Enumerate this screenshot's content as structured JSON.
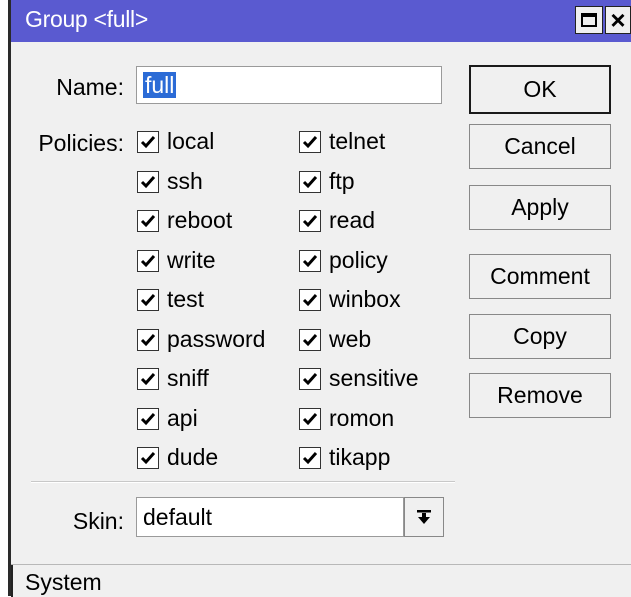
{
  "window": {
    "title": "Group <full>",
    "controls": {
      "maximize": "maximize-icon",
      "close": "×"
    }
  },
  "form": {
    "name_label": "Name:",
    "name_value": "full",
    "policies_label": "Policies:",
    "skin_label": "Skin:",
    "skin_value": "default"
  },
  "policies_left": [
    {
      "label": "local",
      "checked": true
    },
    {
      "label": "ssh",
      "checked": true
    },
    {
      "label": "reboot",
      "checked": true
    },
    {
      "label": "write",
      "checked": true
    },
    {
      "label": "test",
      "checked": true
    },
    {
      "label": "password",
      "checked": true
    },
    {
      "label": "sniff",
      "checked": true
    },
    {
      "label": "api",
      "checked": true
    },
    {
      "label": "dude",
      "checked": true
    }
  ],
  "policies_right": [
    {
      "label": "telnet",
      "checked": true
    },
    {
      "label": "ftp",
      "checked": true
    },
    {
      "label": "read",
      "checked": true
    },
    {
      "label": "policy",
      "checked": true
    },
    {
      "label": "winbox",
      "checked": true
    },
    {
      "label": "web",
      "checked": true
    },
    {
      "label": "sensitive",
      "checked": true
    },
    {
      "label": "romon",
      "checked": true
    },
    {
      "label": "tikapp",
      "checked": true
    }
  ],
  "buttons": {
    "ok": "OK",
    "cancel": "Cancel",
    "apply": "Apply",
    "comment": "Comment",
    "copy": "Copy",
    "remove": "Remove"
  },
  "status": {
    "text": "System"
  },
  "colors": {
    "titlebar": "#5a5ad0",
    "selection": "#2b6bd6",
    "window_bg": "#f0f0f0"
  }
}
